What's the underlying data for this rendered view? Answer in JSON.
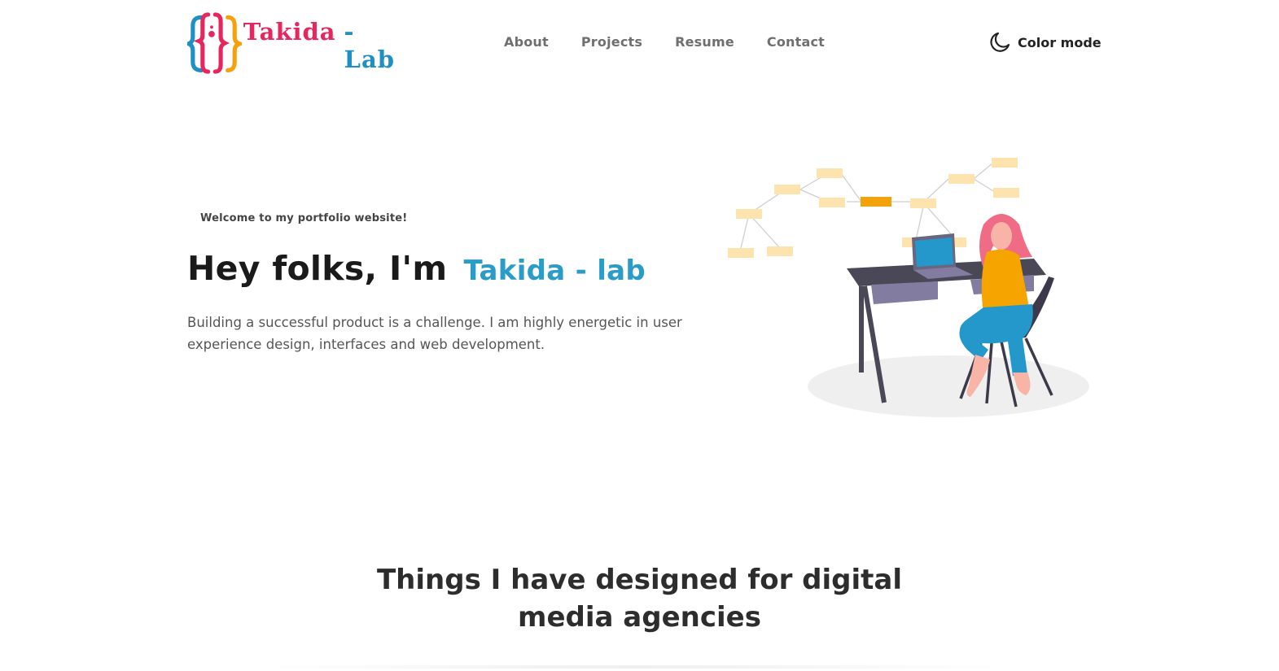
{
  "brand": {
    "word1": "Takida",
    "word2": "-Lab",
    "colors": {
      "pink": "#e6265f",
      "blue": "#1e90c4",
      "orange": "#f6a00c"
    }
  },
  "nav": {
    "items": [
      {
        "label": "About"
      },
      {
        "label": "Projects"
      },
      {
        "label": "Resume"
      },
      {
        "label": "Contact"
      }
    ]
  },
  "color_mode": {
    "label": "Color mode",
    "icon": "moon-icon"
  },
  "hero": {
    "welcome": "Welcome to my portfolio website!",
    "title_prefix": "Hey folks, I'm",
    "title_name": "Takida - lab",
    "description": "Building a successful product is a challenge. I am highly energetic in user experience design, interfaces and web development.",
    "accent_color": "#2a9cc8"
  },
  "section": {
    "title": "Things I have designed for digital media agencies"
  }
}
